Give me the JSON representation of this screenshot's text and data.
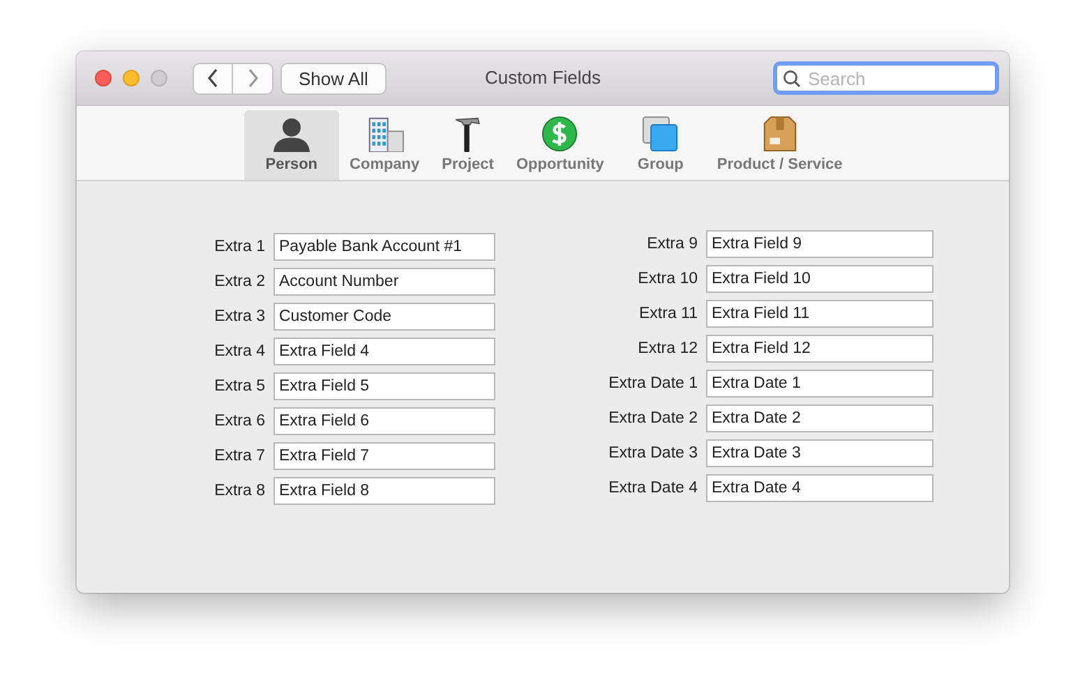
{
  "window": {
    "title": "Custom Fields"
  },
  "toolbar": {
    "show_all": "Show All",
    "search": {
      "placeholder": "Search"
    }
  },
  "tabs": [
    {
      "label": "Person",
      "kind": "person",
      "selected": true
    },
    {
      "label": "Company",
      "kind": "building",
      "selected": false
    },
    {
      "label": "Project",
      "kind": "hammer",
      "selected": false
    },
    {
      "label": "Opportunity",
      "kind": "dollar",
      "selected": false
    },
    {
      "label": "Group",
      "kind": "squares",
      "selected": false
    },
    {
      "label": "Product / Service",
      "kind": "box",
      "selected": false
    }
  ],
  "left_fields": [
    {
      "label": "Extra 1",
      "value": "Payable Bank Account #1"
    },
    {
      "label": "Extra 2",
      "value": "Account Number"
    },
    {
      "label": "Extra 3",
      "value": "Customer Code"
    },
    {
      "label": "Extra 4",
      "value": "Extra Field 4"
    },
    {
      "label": "Extra 5",
      "value": "Extra Field 5"
    },
    {
      "label": "Extra 6",
      "value": "Extra Field 6"
    },
    {
      "label": "Extra 7",
      "value": "Extra Field 7"
    },
    {
      "label": "Extra 8",
      "value": "Extra Field 8"
    }
  ],
  "right_fields": [
    {
      "label": "Extra 9",
      "value": "Extra Field 9"
    },
    {
      "label": "Extra 10",
      "value": "Extra Field 10"
    },
    {
      "label": "Extra 11",
      "value": "Extra Field 11"
    },
    {
      "label": "Extra 12",
      "value": "Extra Field 12"
    },
    {
      "label": "Extra Date 1",
      "value": "Extra Date 1"
    },
    {
      "label": "Extra Date 2",
      "value": "Extra Date 2"
    },
    {
      "label": "Extra Date 3",
      "value": "Extra Date 3"
    },
    {
      "label": "Extra Date 4",
      "value": "Extra Date 4"
    }
  ]
}
